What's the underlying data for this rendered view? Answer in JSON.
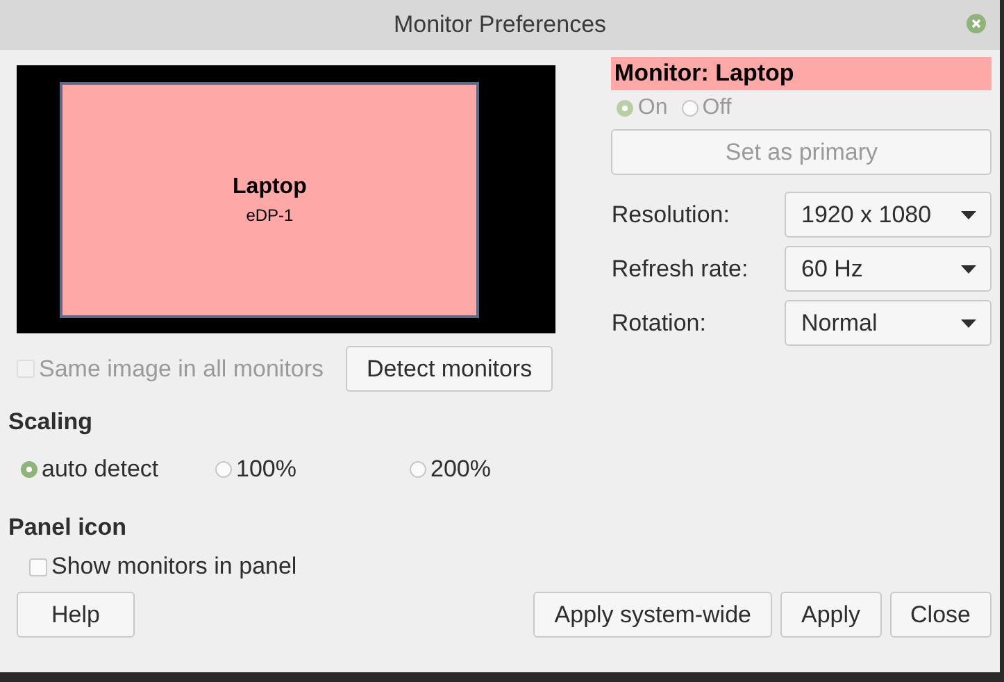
{
  "window": {
    "title": "Monitor Preferences"
  },
  "monitor_layout": {
    "monitors": [
      {
        "name": "Laptop",
        "output": "eDP-1",
        "selected": true
      }
    ]
  },
  "monitor_settings": {
    "heading": "Monitor: Laptop",
    "power": [
      {
        "label": "On",
        "selected": true,
        "disabled": true
      },
      {
        "label": "Off",
        "selected": false,
        "disabled": true
      }
    ],
    "primary_button": {
      "label": "Set as primary",
      "disabled": true
    },
    "fields": [
      {
        "label": "Resolution:",
        "value": "1920 x 1080"
      },
      {
        "label": "Refresh rate:",
        "value": "60 Hz"
      },
      {
        "label": "Rotation:",
        "value": "Normal"
      }
    ]
  },
  "same_image": {
    "label": "Same image in all monitors",
    "checked": false,
    "disabled": true
  },
  "detect_button": {
    "label": "Detect monitors"
  },
  "scaling": {
    "heading": "Scaling",
    "options": [
      {
        "label": "auto detect",
        "selected": true
      },
      {
        "label": "100%",
        "selected": false
      },
      {
        "label": "200%",
        "selected": false
      }
    ]
  },
  "panel_icon": {
    "heading": "Panel icon",
    "show_monitors": {
      "label": "Show monitors in panel",
      "checked": false
    }
  },
  "buttons": [
    {
      "label": "Help"
    },
    {
      "label": "Apply system-wide"
    },
    {
      "label": "Apply"
    },
    {
      "label": "Close"
    }
  ]
}
